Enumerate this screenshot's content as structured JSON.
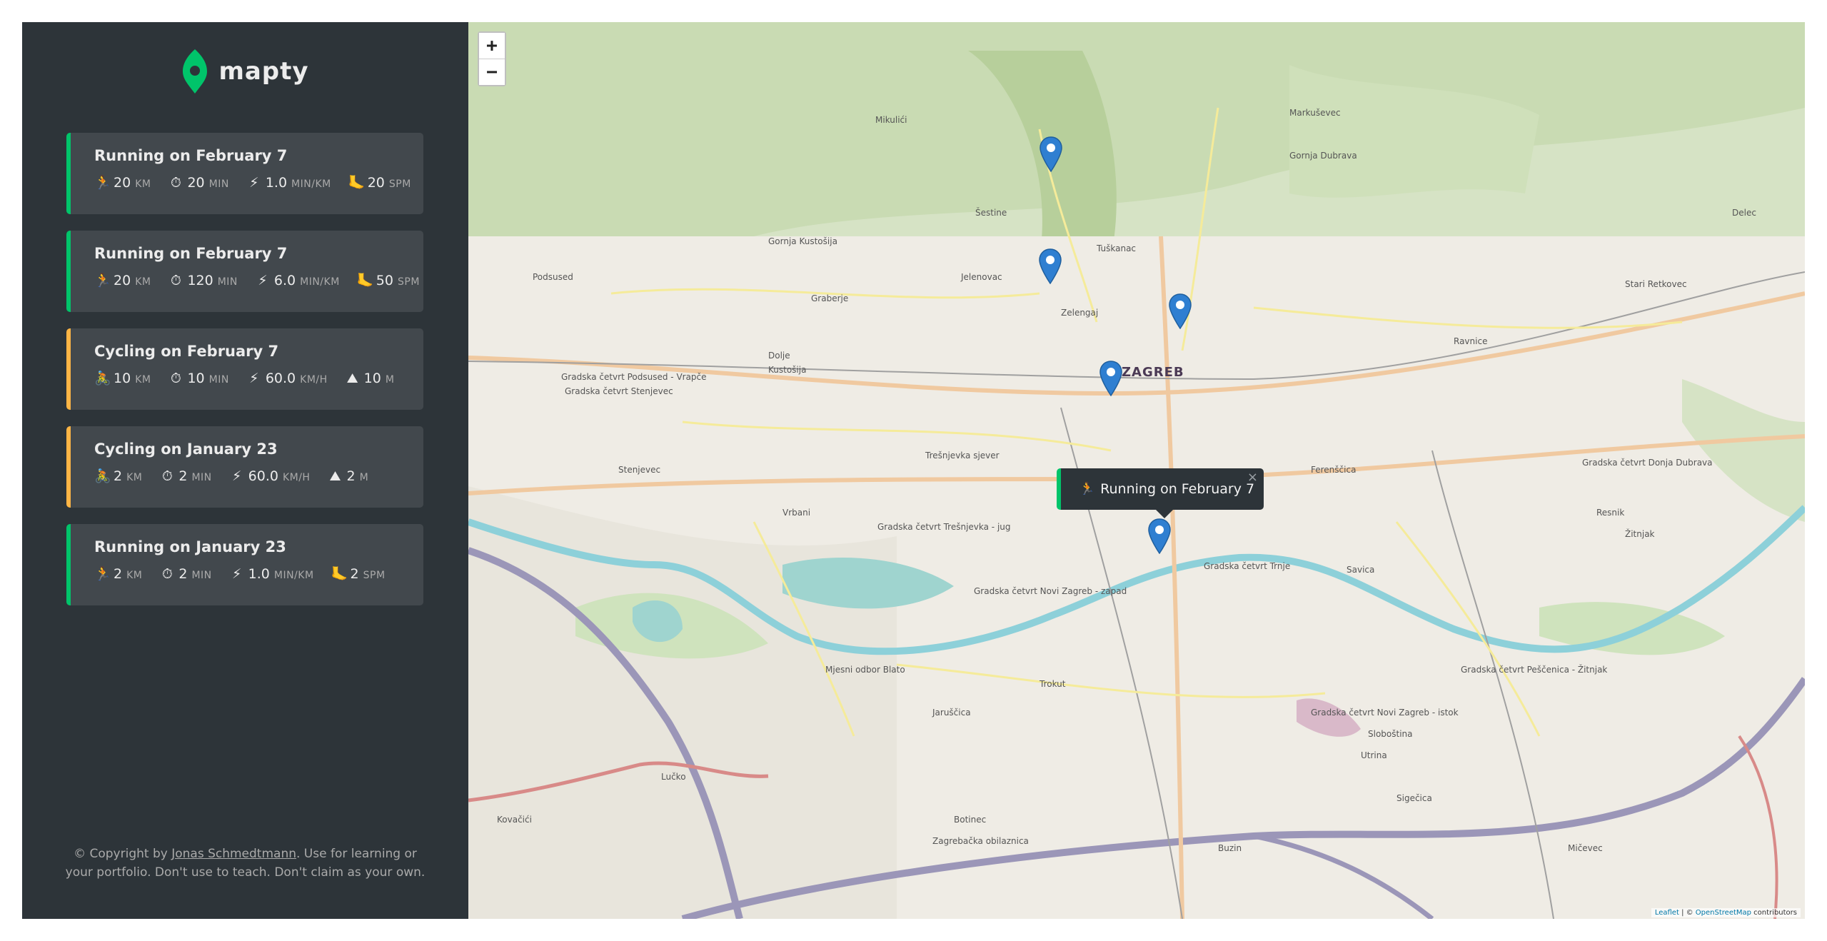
{
  "app": {
    "name": "mapty",
    "brand_color": "#00c46a",
    "cycling_color": "#ffb545",
    "sidebar_color": "#2d3439"
  },
  "workouts": [
    {
      "type": "running",
      "title": "Running on February 7",
      "distance": {
        "icon": "🏃",
        "value": "20",
        "unit": "KM"
      },
      "duration": {
        "icon": "⏱",
        "value": "20",
        "unit": "MIN"
      },
      "speed": {
        "icon": "⚡",
        "value": "1.0",
        "unit": "MIN/KM"
      },
      "extra": {
        "icon": "🦶",
        "value": "20",
        "unit": "SPM"
      }
    },
    {
      "type": "running",
      "title": "Running on February 7",
      "distance": {
        "icon": "🏃",
        "value": "20",
        "unit": "KM"
      },
      "duration": {
        "icon": "⏱",
        "value": "120",
        "unit": "MIN"
      },
      "speed": {
        "icon": "⚡",
        "value": "6.0",
        "unit": "MIN/KM"
      },
      "extra": {
        "icon": "🦶",
        "value": "50",
        "unit": "SPM"
      }
    },
    {
      "type": "cycling",
      "title": "Cycling on February 7",
      "distance": {
        "icon": "🚴",
        "value": "10",
        "unit": "KM"
      },
      "duration": {
        "icon": "⏱",
        "value": "10",
        "unit": "MIN"
      },
      "speed": {
        "icon": "⚡",
        "value": "60.0",
        "unit": "KM/H"
      },
      "extra": {
        "icon": "⛰",
        "value": "10",
        "unit": "M"
      }
    },
    {
      "type": "cycling",
      "title": "Cycling on January 23",
      "distance": {
        "icon": "🚴",
        "value": "2",
        "unit": "KM"
      },
      "duration": {
        "icon": "⏱",
        "value": "2",
        "unit": "MIN"
      },
      "speed": {
        "icon": "⚡",
        "value": "60.0",
        "unit": "KM/H"
      },
      "extra": {
        "icon": "⛰",
        "value": "2",
        "unit": "M"
      }
    },
    {
      "type": "running",
      "title": "Running on January 23",
      "distance": {
        "icon": "🏃",
        "value": "2",
        "unit": "KM"
      },
      "duration": {
        "icon": "⏱",
        "value": "2",
        "unit": "MIN"
      },
      "speed": {
        "icon": "⚡",
        "value": "1.0",
        "unit": "MIN/KM"
      },
      "extra": {
        "icon": "🦶",
        "value": "2",
        "unit": "SPM"
      }
    }
  ],
  "copyright": {
    "prefix": "© Copyright by ",
    "author": "Jonas Schmedtmann",
    "suffix": ". Use for learning or your portfolio. Don't use to teach. Don't claim as your own."
  },
  "map": {
    "zoom_in": "+",
    "zoom_out": "−",
    "popup": {
      "icon": "🏃",
      "text": "Running on February 7",
      "close": "×"
    },
    "attribution": {
      "leaflet": "Leaflet",
      "sep": " | © ",
      "osm": "OpenStreetMap",
      "suffix": " contributors"
    },
    "city_label": "ZAGREB",
    "labels": [
      "Gradska četvrt Podsused - Vrapče",
      "Gradska četvrt Stenjevec",
      "Gradska četvrt Trešnjevka - jug",
      "Gradska četvrt Novi Zagreb - zapad",
      "Gradska četvrt Trnje",
      "Gradska četvrt Novi Zagreb - istok",
      "Gradska četvrt Peščenica - Žitnjak",
      "Gradska četvrt Donja Dubrava",
      "Zagrebačka obilaznica",
      "Mjesni odbor Blato",
      "Stenjevec",
      "Trešnjevka sjever",
      "Vrbani",
      "Ferenščica",
      "Savica",
      "Trokut",
      "Jaruščica",
      "Sloboština",
      "Utrina",
      "Sigečica",
      "Botinec",
      "Kovačići",
      "Lučko",
      "Buzin",
      "Mičevec",
      "Podsused",
      "Dolje",
      "Kustošija",
      "Gornja Kustošija",
      "Graberje",
      "Šestine",
      "Mikulići",
      "Markuševec",
      "Jelenovac",
      "Zelengaj",
      "Tuškanac",
      "Ravnice",
      "Gornja Dubrava",
      "Resnik",
      "Žitnjak",
      "Stari Retkovec",
      "Delec"
    ]
  }
}
